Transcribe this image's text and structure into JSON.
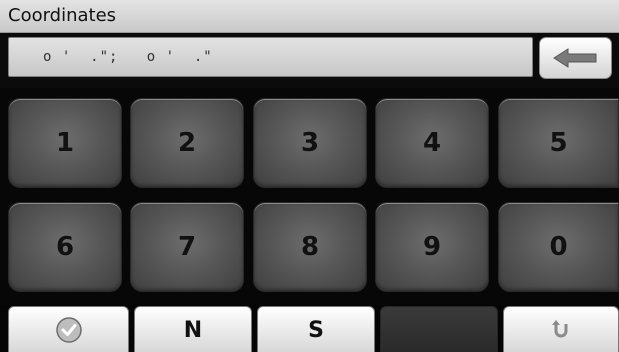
{
  "window": {
    "title": "Coordinates"
  },
  "coordinate_input": {
    "value": "o '  .\";   o '  .\""
  },
  "keypad": {
    "row1": [
      "1",
      "2",
      "3",
      "4",
      "5"
    ],
    "row2": [
      "6",
      "7",
      "8",
      "9",
      "0"
    ]
  },
  "bottom_bar": {
    "north_label": "N",
    "south_label": "S"
  },
  "icons": {
    "backspace": "arrow-left-icon",
    "confirm": "checkmark-icon",
    "back": "u-turn-back-icon"
  }
}
